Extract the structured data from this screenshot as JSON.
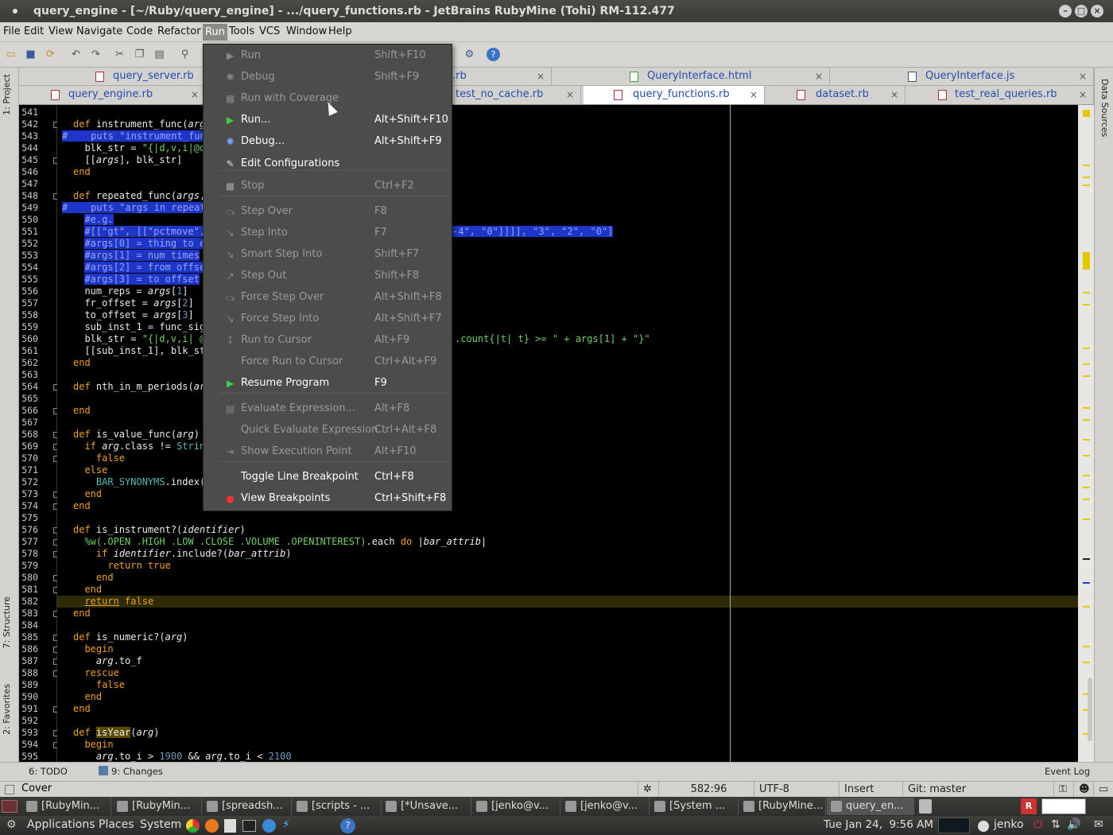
{
  "window": {
    "title": "query_engine - [~/Ruby/query_engine] - .../query_functions.rb - JetBrains RubyMine (Tohi) RM-112.477"
  },
  "menubar": [
    "File",
    "Edit",
    "View",
    "Navigate",
    "Code",
    "Refactor",
    "Run",
    "Tools",
    "VCS",
    "Window",
    "Help"
  ],
  "side_tabs": {
    "project": "1: Project",
    "structure": "7: Structure",
    "favorites": "2: Favorites",
    "data_sources": "Data Sources"
  },
  "tabs_row1": [
    {
      "label": "query_server.rb",
      "icon": "ruby-file-icon"
    },
    {
      "label": ".rb",
      "icon": "ruby-file-icon"
    },
    {
      "label": "QueryInterface.html",
      "icon": "html-file-icon"
    },
    {
      "label": "QueryInterface.js",
      "icon": "js-file-icon"
    }
  ],
  "tabs_row2": [
    {
      "label": "query_engine.rb",
      "icon": "ruby-file-icon"
    },
    {
      "label": "test_no_cache.rb",
      "icon": "ruby-file-icon"
    },
    {
      "label": "query_functions.rb",
      "icon": "ruby-file-icon",
      "selected": true
    },
    {
      "label": "dataset.rb",
      "icon": "ruby-file-icon"
    },
    {
      "label": "test_real_queries.rb",
      "icon": "ruby-test-file-icon"
    }
  ],
  "line_numbers": [
    "541",
    "542",
    "543",
    "544",
    "545",
    "546",
    "547",
    "548",
    "549",
    "550",
    "551",
    "552",
    "553",
    "554",
    "555",
    "556",
    "557",
    "558",
    "559",
    "560",
    "561",
    "562",
    "563",
    "564",
    "565",
    "566",
    "567",
    "568",
    "569",
    "570",
    "571",
    "572",
    "573",
    "574",
    "575",
    "576",
    "577",
    "578",
    "579",
    "580",
    "581",
    "582",
    "583",
    "584",
    "585",
    "586",
    "587",
    "588",
    "589",
    "590",
    "591",
    "592",
    "593",
    "594",
    "595"
  ],
  "code_fragments": {
    "l551_right": "-4\", \"0\"]]]], \"3\", \"2\", \"0\"]",
    "l560_right": ".count{|t| t} >= \" + args[1] + \"}\""
  },
  "run_menu": [
    {
      "label": "Run",
      "shortcut": "Shift+F10",
      "enabled": false,
      "icon": "run-icon"
    },
    {
      "label": "Debug",
      "shortcut": "Shift+F9",
      "enabled": false,
      "icon": "debug-icon"
    },
    {
      "label": "Run with Coverage",
      "shortcut": "",
      "enabled": false,
      "icon": "coverage-icon"
    },
    {
      "label": "Run...",
      "shortcut": "Alt+Shift+F10",
      "enabled": true,
      "icon": "run-icon"
    },
    {
      "label": "Debug...",
      "shortcut": "Alt+Shift+F9",
      "enabled": true,
      "icon": "debug-icon"
    },
    {
      "label": "Edit Configurations",
      "shortcut": "",
      "enabled": true,
      "icon": "edit-config-icon"
    },
    {
      "label": "Stop",
      "shortcut": "Ctrl+F2",
      "enabled": false,
      "icon": "stop-icon"
    },
    {
      "label": "Step Over",
      "shortcut": "F8",
      "enabled": false,
      "icon": "step-over-icon"
    },
    {
      "label": "Step Into",
      "shortcut": "F7",
      "enabled": false,
      "icon": "step-into-icon"
    },
    {
      "label": "Smart Step Into",
      "shortcut": "Shift+F7",
      "enabled": false,
      "icon": "smart-step-icon"
    },
    {
      "label": "Step Out",
      "shortcut": "Shift+F8",
      "enabled": false,
      "icon": "step-out-icon"
    },
    {
      "label": "Force Step Over",
      "shortcut": "Alt+Shift+F8",
      "enabled": false,
      "icon": "force-step-over-icon"
    },
    {
      "label": "Force Step Into",
      "shortcut": "Alt+Shift+F7",
      "enabled": false,
      "icon": "force-step-into-icon"
    },
    {
      "label": "Run to Cursor",
      "shortcut": "Alt+F9",
      "enabled": false,
      "icon": "run-to-cursor-icon"
    },
    {
      "label": "Force Run to Cursor",
      "shortcut": "Ctrl+Alt+F9",
      "enabled": false,
      "icon": ""
    },
    {
      "label": "Resume Program",
      "shortcut": "F9",
      "enabled": true,
      "icon": "resume-icon"
    },
    {
      "label": "Evaluate Expression...",
      "shortcut": "Alt+F8",
      "enabled": false,
      "icon": "evaluate-icon"
    },
    {
      "label": "Quick Evaluate Expression",
      "shortcut": "Ctrl+Alt+F8",
      "enabled": false,
      "icon": ""
    },
    {
      "label": "Show Execution Point",
      "shortcut": "Alt+F10",
      "enabled": false,
      "icon": "execution-point-icon"
    },
    {
      "label": "Toggle Line Breakpoint",
      "shortcut": "Ctrl+F8",
      "enabled": true,
      "icon": ""
    },
    {
      "label": "View Breakpoints",
      "shortcut": "Ctrl+Shift+F8",
      "enabled": true,
      "icon": "breakpoints-icon"
    }
  ],
  "bottom_tools": {
    "todo": "6: TODO",
    "changes": "9: Changes",
    "event_log": "Event Log"
  },
  "status": {
    "message": "Cover",
    "position": "582:96",
    "encoding": "UTF-8",
    "mode": "Insert",
    "vcs": "Git: master"
  },
  "taskbar": [
    "[RubyMin...",
    "[RubyMin...",
    "[spreadsh...",
    "[scripts - ...",
    "[*Unsave...",
    "[jenko@v...",
    "[jenko@v...",
    "[System ...",
    "[RubyMine...",
    "query_en..."
  ],
  "gnome": {
    "applications": "Applications",
    "places": "Places",
    "system": "System",
    "clock": "Tue Jan 24,  9:56 AM",
    "user": "jenko"
  }
}
